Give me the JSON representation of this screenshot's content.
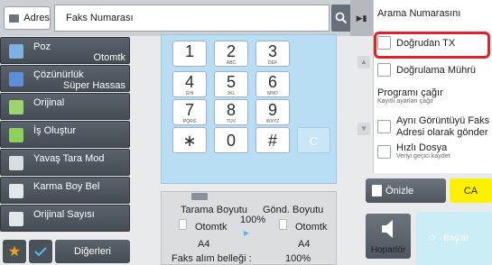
{
  "topbar": {
    "address_label": "Adres",
    "address_value": "Faks Numarası"
  },
  "left_menu": [
    {
      "label": "Poz",
      "value": "Otomtk"
    },
    {
      "label": "Çözünürlük",
      "value": "Süper Hassas"
    },
    {
      "label": "Orijinal",
      "value": ""
    },
    {
      "label": "İş Oluştur",
      "value": ""
    },
    {
      "label": "Yavaş Tara Mod",
      "value": ""
    },
    {
      "label": "Karma Boy Bel",
      "value": ""
    },
    {
      "label": "Orijinal Sayısı",
      "value": ""
    }
  ],
  "bottom_left": {
    "others_label": "Diğerleri"
  },
  "keypad": {
    "keys": [
      {
        "main": "1",
        "sub": ""
      },
      {
        "main": "2",
        "sub": "ABC"
      },
      {
        "main": "3",
        "sub": "DEF"
      },
      {
        "main": "4",
        "sub": "GHI"
      },
      {
        "main": "5",
        "sub": "JKL"
      },
      {
        "main": "6",
        "sub": "MNO"
      },
      {
        "main": "7",
        "sub": "PQRS"
      },
      {
        "main": "8",
        "sub": "TUV"
      },
      {
        "main": "9",
        "sub": "WXYZ"
      },
      {
        "main": "∗",
        "sub": ""
      },
      {
        "main": "0",
        "sub": ""
      },
      {
        "main": "#",
        "sub": ""
      }
    ],
    "clear_label": "C"
  },
  "scan_info": {
    "scan_size_label": "Tarama Boyutu",
    "send_size_label": "Gönd. Boyutu",
    "ratio": "100%",
    "scan_mode": "Otomtk",
    "send_mode": "Otomtk",
    "scan_paper": "A4",
    "send_paper": "A4",
    "memory_label": "Faks alım belleği :",
    "memory_value": "100%"
  },
  "right_panel": {
    "header": "Arama Numarasını",
    "direct_tx": "Doğrudan TX",
    "verify_stamp": "Doğrulama Mührü",
    "program_recall": "Programı çağır",
    "program_recall_sub": "Kayıtlı ayarları çağır",
    "same_image_1": "Aynı Görüntüyü Faks",
    "same_image_2": "Adresi olarak gönder",
    "quick_file": "Hızlı Dosya",
    "quick_file_sub": "Veriyi geçici kaydet"
  },
  "actions": {
    "preview": "Önizle",
    "ca": "CA",
    "speaker": "Hoparlör",
    "start": "Başlat"
  },
  "colors": {
    "highlight_red": "#e0202a",
    "ca_yellow": "#ffef00",
    "keypad_blue": "#b9ddf2",
    "menu_dark": "#4c545c"
  }
}
